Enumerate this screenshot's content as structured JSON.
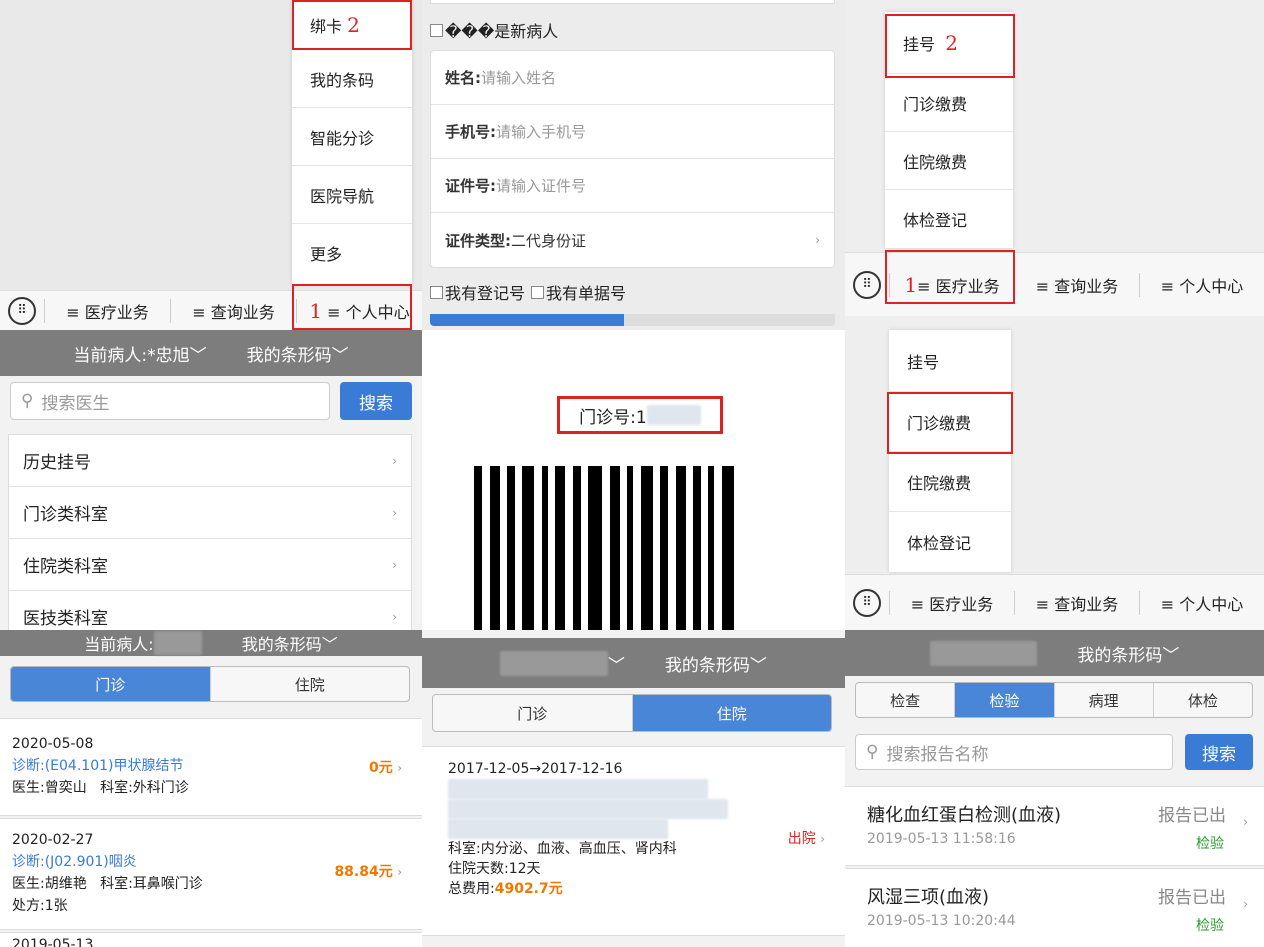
{
  "panel1": {
    "menu_items": [
      "绑卡",
      "我的条码",
      "智能分诊",
      "医院导航",
      "更多"
    ],
    "annotation_bind": "2",
    "annotation_personal": "1",
    "tabs": [
      "≡ 医疗业务",
      "≡ 查询业务",
      "≡ 个人中心"
    ],
    "kbd_icon": "keyboard-icon"
  },
  "panel2": {
    "new_patient": "���是新病人",
    "fields": [
      {
        "label": "姓名:",
        "placeholder": " 请输入姓名"
      },
      {
        "label": "手机号:",
        "placeholder": " 请输入手机号"
      },
      {
        "label": "证件号:",
        "placeholder": " 请输入证件号"
      }
    ],
    "id_type_label": "证件类型:",
    "id_type_value": " 二代身份证",
    "has_reg": "我有登记号",
    "has_receipt": "我有单据号"
  },
  "panel3": {
    "menu_items": [
      "挂号",
      "门诊缴费",
      "住院缴费",
      "体检登记"
    ],
    "annotation_register": "2",
    "annotation_medical": "1",
    "tabs": [
      "≡ 医疗业务",
      "≡ 查询业务",
      "≡ 个人中心"
    ]
  },
  "panel4": {
    "patient": "当前病人:*忠旭",
    "barcode_menu": "我的条形码",
    "search_placeholder": "搜索医生",
    "search_button": "搜索",
    "items": [
      "历史挂号",
      "门诊类科室",
      "住院类科室",
      "医技类科室"
    ]
  },
  "panel5": {
    "outpatient_no": "门诊号:1",
    "outpatient_blurred": "00001"
  },
  "panel6": {
    "menu_items": [
      "挂号",
      "门诊缴费",
      "住院缴费",
      "体检登记"
    ],
    "tabs": [
      "≡ 医疗业务",
      "≡ 查询业务",
      "≡ 个人中心"
    ]
  },
  "panel7": {
    "patient": "当前病人:",
    "barcode_menu": "我的条形码",
    "tabs": [
      "门诊",
      "住院"
    ],
    "records": [
      {
        "date": "2020-05-08",
        "diagnosis": "诊断:(E04.101)甲状腺结节",
        "amount": "0元",
        "doctor": "医生:曾奕山",
        "dept": "科室:外科门诊",
        "rx": ""
      },
      {
        "date": "2020-02-27",
        "diagnosis": "诊断:(J02.901)咽炎",
        "amount": "88.84元",
        "doctor": "医生:胡维艳",
        "dept": "科室:耳鼻喉门诊",
        "rx": "处方:1张"
      },
      {
        "date": "2019-05-13",
        "diagnosis": "",
        "amount": "",
        "doctor": "",
        "dept": "",
        "rx": ""
      }
    ]
  },
  "panel8": {
    "patient": "当前病人:",
    "barcode_menu": "我的条形码",
    "tabs": [
      "门诊",
      "住院"
    ],
    "record": {
      "dates": "2017-12-05→2017-12-16",
      "status": "出院",
      "dept": "科室:内分泌、血液、高血压、肾内科",
      "days": "住院天数:12天",
      "cost_label": "总费用:",
      "cost_value": "4902.7元"
    }
  },
  "panel9": {
    "patient": "当前病人:",
    "barcode_menu": "我的条形码",
    "tabs": [
      "检查",
      "检验",
      "病理",
      "体检"
    ],
    "search_placeholder": "搜索报告名称",
    "search_button": "搜索",
    "reports": [
      {
        "name": "糖化血红蛋白检测(血液)",
        "time": "2019-05-13 11:58:16",
        "status": "报告已出",
        "type": "检验"
      },
      {
        "name": "风湿三项(血液)",
        "time": "2019-05-13 10:20:44",
        "status": "报告已出",
        "type": "检验"
      }
    ]
  },
  "colors": {
    "accent": "#3a7bd5",
    "annotation": "#dd2222",
    "amount": "#f07800",
    "header_gray": "#7d7d7d"
  }
}
